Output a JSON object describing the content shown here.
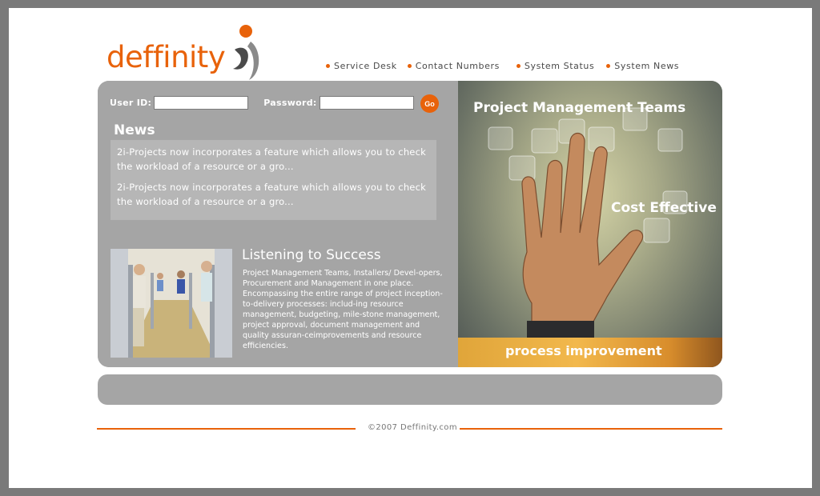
{
  "brand": {
    "name": "deffinity",
    "color": "#e8620a",
    "logo_icon": "person-figure-icon"
  },
  "nav": {
    "items": [
      {
        "label": "Service Desk"
      },
      {
        "label": "Contact Numbers"
      },
      {
        "label": "System Status"
      },
      {
        "label": "System News"
      }
    ]
  },
  "login": {
    "user_label": "User ID:",
    "user_value": "",
    "password_label": "Password:",
    "password_value": "",
    "go_label": "Go"
  },
  "news": {
    "title": "News",
    "items": [
      "2i-Projects now incorporates a feature which allows you to check the workload of a resource or a gro...",
      "2i-Projects now incorporates a feature which allows you to check the workload of a resource or a gro..."
    ]
  },
  "feature": {
    "title": "Listening to Success",
    "body": "Project Management Teams, Installers/ Devel-opers, Procurement and Management in one place. Encompassing the entire range of project inception-to-delivery processes: includ-ing resource management, budgeting, mile-stone management, project approval, document management and quality assuran-ceimprovements and resource efficiencies.",
    "photo_icon": "office-team-photo"
  },
  "hero": {
    "heading1": "Project Management Teams",
    "heading2": "Cost Effective",
    "bar_text": "process improvement",
    "image_icon": "hand-touch-icon"
  },
  "footer": {
    "copyright": "©2007 Deffinity.com"
  },
  "colors": {
    "panel": "#a5a5a5",
    "frame": "#7a7a7a",
    "accent": "#e8620a"
  }
}
